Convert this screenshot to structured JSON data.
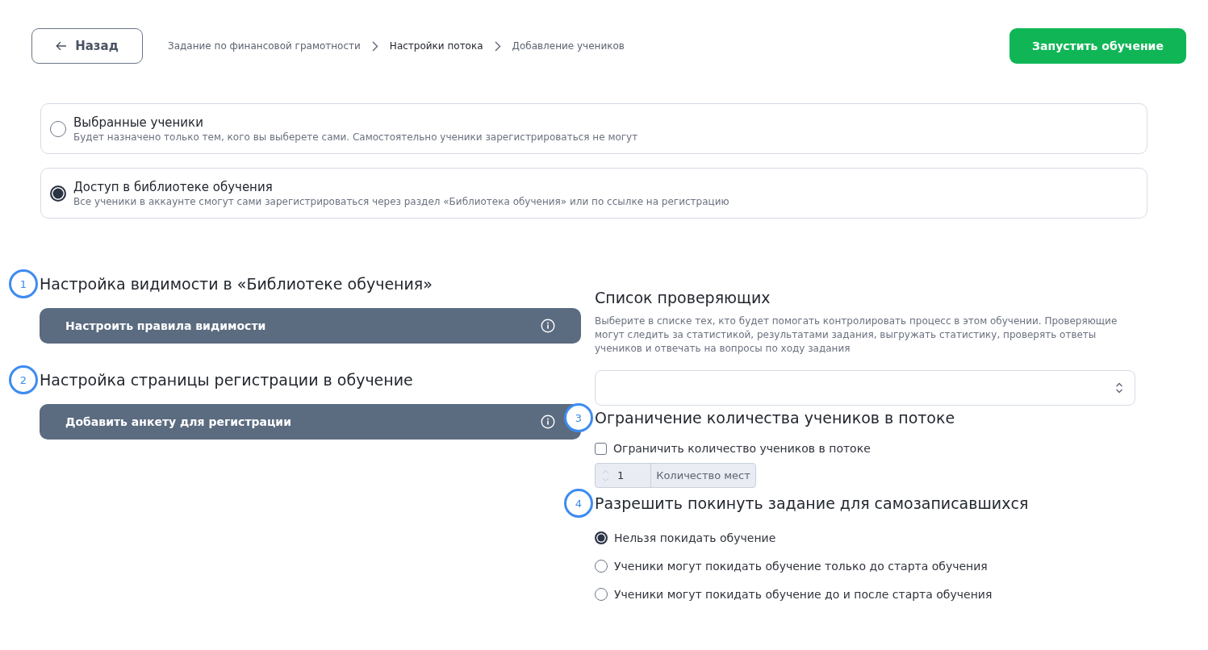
{
  "back_button": {
    "label": "Назад"
  },
  "breadcrumbs": [
    {
      "label": "Задание по финансовой грамотности",
      "active": false
    },
    {
      "label": "Настройки потока",
      "active": true
    },
    {
      "label": "Добавление учеников",
      "active": false
    }
  ],
  "start_button": {
    "label": "Запустить обучение"
  },
  "access_options": [
    {
      "title": "Выбранные ученики",
      "description": "Будет назначено только тем, кого вы выберете сами. Самостоятельно ученики зарегистрироваться не могут",
      "selected": false
    },
    {
      "title": "Доступ в библиотеке обучения",
      "description": "Все ученики в аккаунте смогут сами зарегистрироваться через раздел «Библиотека обучения» или по ссылке на регистрацию",
      "selected": true
    }
  ],
  "visibility_section": {
    "marker": "1",
    "title": "Настройка видимости в «Библиотеке обучения»",
    "button": {
      "label": "Настроить правила видимости"
    }
  },
  "registration_section": {
    "marker": "2",
    "title": "Настройка страницы регистрации в обучение",
    "button": {
      "label": "Добавить анкету для регистрации"
    }
  },
  "reviewers": {
    "title": "Список проверяющих",
    "description": "Выберите в списке тех, кто будет помогать контролировать процесс в этом обучении. Проверяющие могут следить за статистикой, результатами задания, выгружать статистику, проверять ответы учеников и отвечать на вопросы по ходу задания"
  },
  "limit_section": {
    "marker": "3",
    "title": "Ограничение количества учеников в потоке",
    "checkbox": {
      "label": "Ограничить количество учеников в потоке",
      "checked": false
    },
    "seats_field": {
      "value": "1",
      "addon": "Количество мест",
      "disabled": true
    }
  },
  "leave_section": {
    "marker": "4",
    "title": "Разрешить покинуть задание для самозаписавшихся",
    "options": [
      {
        "label": "Нельзя покидать обучение",
        "selected": true
      },
      {
        "label": "Ученики могут покидать обучение только до старта обучения",
        "selected": false
      },
      {
        "label": "Ученики могут покидать обучение до и после старта обучения",
        "selected": false
      }
    ]
  }
}
